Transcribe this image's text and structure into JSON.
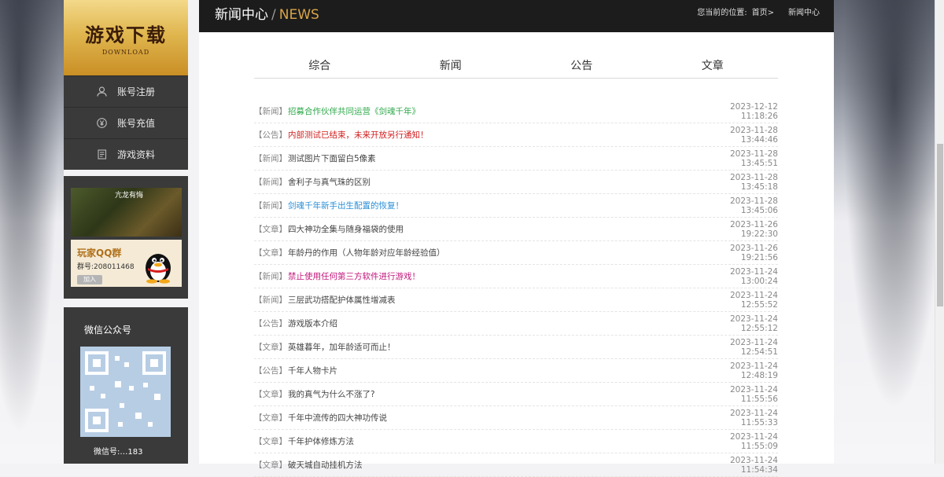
{
  "sidebar": {
    "download": {
      "title": "游戏下载",
      "subtitle": "DOWNLOAD"
    },
    "menu": [
      {
        "label": "账号注册",
        "icon": "user-icon"
      },
      {
        "label": "账号充值",
        "icon": "yen-coin-icon"
      },
      {
        "label": "游戏资料",
        "icon": "document-icon"
      }
    ],
    "qq": {
      "image_caption": "亢龙有悔",
      "label": "玩家QQ群",
      "number": "群号:208011468",
      "join_label": "加入"
    },
    "wechat": {
      "title": "微信公众号",
      "footer": "微信号:…183"
    }
  },
  "header": {
    "title_cn": "新闻中心",
    "title_sep": "/",
    "title_en": "NEWS",
    "breadcrumb": {
      "prefix": "您当前的位置:",
      "home": "首页>",
      "current": "新闻中心"
    }
  },
  "tabs": [
    "综合",
    "新闻",
    "公告",
    "文章"
  ],
  "colors": {
    "green": "#2ea84a",
    "red": "#d11f1f",
    "blue": "#2a8fd6",
    "magenta": "#c2157a",
    "gold": "#d9a548"
  },
  "news": [
    {
      "tag": "【新闻】",
      "title": "招募合作伙伴共同运营《剑魂千年》",
      "date": "2023-12-12 11:18:26",
      "color": "#2ea84a"
    },
    {
      "tag": "【公告】",
      "title": "内部测试已结束，未来开放另行通知！",
      "date": "2023-11-28 13:44:46",
      "color": "#d11f1f"
    },
    {
      "tag": "【新闻】",
      "title": "测试图片下面留白5像素",
      "date": "2023-11-28 13:45:51",
      "color": ""
    },
    {
      "tag": "【新闻】",
      "title": "舍利子与真气珠的区别",
      "date": "2023-11-28 13:45:18",
      "color": ""
    },
    {
      "tag": "【新闻】",
      "title": "剑魂千年新手出生配置的恢复！",
      "date": "2023-11-28 13:45:06",
      "color": "#2a8fd6"
    },
    {
      "tag": "【文章】",
      "title": "四大神功全集与随身福袋的使用",
      "date": "2023-11-26 19:22:30",
      "color": ""
    },
    {
      "tag": "【文章】",
      "title": "年龄丹的作用（人物年龄对应年龄经验值）",
      "date": "2023-11-26 19:21:56",
      "color": ""
    },
    {
      "tag": "【新闻】",
      "title": "禁止使用任何第三方软件进行游戏！",
      "date": "2023-11-24 13:00:24",
      "color": "#c2157a"
    },
    {
      "tag": "【新闻】",
      "title": "三层武功搭配护体属性增减表",
      "date": "2023-11-24 12:55:52",
      "color": ""
    },
    {
      "tag": "【公告】",
      "title": "游戏版本介绍",
      "date": "2023-11-24 12:55:12",
      "color": ""
    },
    {
      "tag": "【文章】",
      "title": "英雄暮年，加年龄适可而止！",
      "date": "2023-11-24 12:54:51",
      "color": ""
    },
    {
      "tag": "【公告】",
      "title": "千年人物卡片",
      "date": "2023-11-24 12:48:19",
      "color": ""
    },
    {
      "tag": "【文章】",
      "title": "我的真气为什么不涨了?",
      "date": "2023-11-24 11:55:56",
      "color": ""
    },
    {
      "tag": "【文章】",
      "title": "千年中流传的四大神功传说",
      "date": "2023-11-24 11:55:33",
      "color": ""
    },
    {
      "tag": "【文章】",
      "title": "千年护体修炼方法",
      "date": "2023-11-24 11:55:09",
      "color": ""
    },
    {
      "tag": "【文章】",
      "title": "破天城自动挂机方法",
      "date": "2023-11-24 11:54:34",
      "color": ""
    }
  ]
}
